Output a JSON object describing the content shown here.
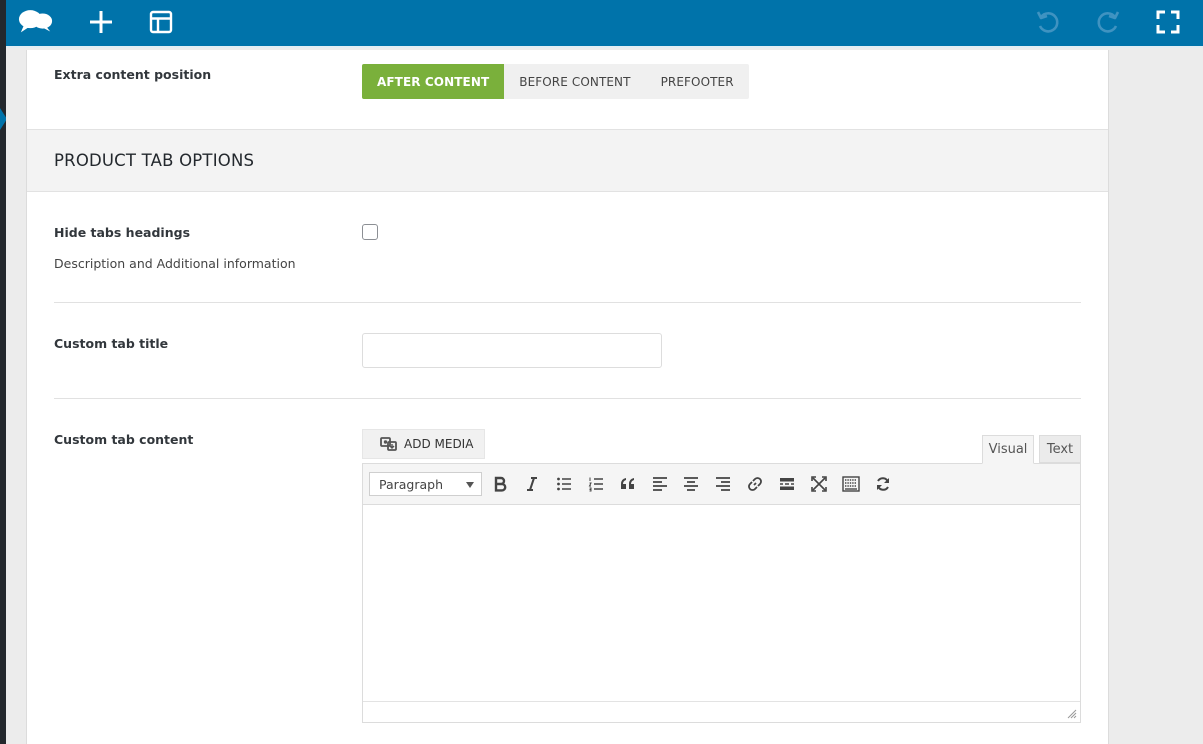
{
  "topbar": {
    "background": "#0073aa",
    "left_icons": [
      "chat-bubbles-icon",
      "plus-icon",
      "layout-icon"
    ],
    "right_icons": [
      "undo-icon",
      "redo-icon",
      "fullscreen-icon"
    ]
  },
  "extra_content": {
    "label": "Extra content position",
    "options": [
      "AFTER CONTENT",
      "BEFORE CONTENT",
      "PREFOOTER"
    ],
    "selected": "AFTER CONTENT",
    "accent": "#7ab03b"
  },
  "section": {
    "title": "PRODUCT TAB OPTIONS"
  },
  "hide_tabs": {
    "label": "Hide tabs headings",
    "description": "Description and Additional information",
    "checked": false
  },
  "custom_title": {
    "label": "Custom tab title",
    "value": ""
  },
  "custom_content": {
    "label": "Custom tab content",
    "add_media_label": "ADD MEDIA",
    "tabs": [
      "Visual",
      "Text"
    ],
    "active_tab": "Visual",
    "format_select": "Paragraph",
    "toolbar_icons": [
      "bold-icon",
      "italic-icon",
      "bullet-list-icon",
      "numbered-list-icon",
      "blockquote-icon",
      "align-left-icon",
      "align-center-icon",
      "align-right-icon",
      "link-icon",
      "read-more-icon",
      "fullscreen-icon",
      "toolbar-toggle-icon",
      "sync-icon"
    ],
    "content": ""
  }
}
